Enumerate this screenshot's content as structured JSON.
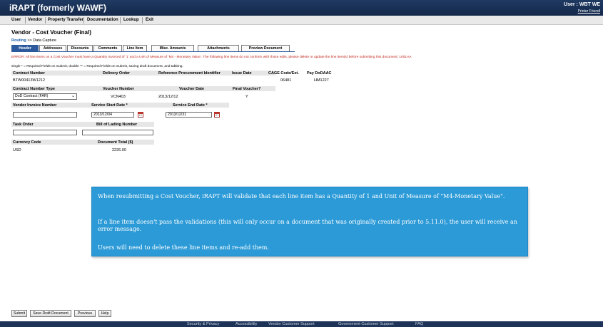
{
  "app": {
    "brand": "iRAPT (formerly WAWF)",
    "user_label": "User : WBT WE",
    "printer_link": "Printer Friendl"
  },
  "menu": [
    "User",
    "Vendor",
    "Property Transfer",
    "Documentation",
    "Lookup",
    "Exit"
  ],
  "page": {
    "title": "Vendor - Cost Voucher (Final)",
    "breadcrumb_link": "Routing",
    "breadcrumb_sep": ">>",
    "breadcrumb_current": "Data Capture"
  },
  "tabs": [
    "Header",
    "Addresses",
    "Discounts",
    "Comments",
    "Line Item",
    "Misc. Amounts",
    "Attachments",
    "Preview Document"
  ],
  "messages": {
    "error": "ERROR: All line items on a Cost Voucher must have a Quantity Invoiced of '1' and a Unit of Measure of 'M4 - Monetary Value'. The following line items do not conform with those edits, please delete or update the line item(s) before submitting this document: 1001AA",
    "required_note": "single * = Required Fields on Submit; double ** = Required Fields on Submit, saving draft document, and tabbing."
  },
  "form": {
    "contract_number_label": "Contract Number",
    "contract_number": "BTW00413W1212",
    "delivery_order_label": "Delivery Order",
    "delivery_order": "",
    "ref_proc_id_label": "Reference Procurement Identifier",
    "issue_date_label": "Issue Date",
    "cage_label": "CAGE Code/Ext.",
    "cage": "06481",
    "pay_dodaac_label": "Pay DoDAAC",
    "pay_dodaac": "HM1227",
    "contract_type_label": "Contract Number Type",
    "contract_type": "DoD Contract (FAR)",
    "voucher_number_label": "Voucher Number",
    "voucher_number": "VCN403",
    "voucher_date_label": "Voucher Date",
    "voucher_date": "2013/12/12",
    "final_voucher_label": "Final Voucher?",
    "final_voucher": "Y",
    "vendor_invoice_label": "Vendor Invoice Number",
    "vendor_invoice": "",
    "service_start_label": "Service Start Date *",
    "service_start": "2013/12/04",
    "service_end_label": "Service End Date *",
    "service_end": "2013/12/31",
    "task_order_label": "Task Order",
    "task_order": "",
    "bill_of_lading_label": "Bill of Lading Number",
    "bill_of_lading": "",
    "currency_label": "Currency Code",
    "currency": "USD",
    "doc_total_label": "Document Total ($)",
    "doc_total": "2226.00"
  },
  "callout": {
    "p1": "When resubmitting a Cost Voucher, iRAPT will validate that each line item has a Quantity of 1 and Unit of Measure of \"M4-Monetary Value\".",
    "p2": "If a line item doesn't pass the validations (this will only occur on a document that was originally created prior to 5.11.0), the user will receive an error message.",
    "p3": "Users will need to delete these line items and re-add them."
  },
  "buttons": [
    "Submit",
    "Save Draft Document",
    "Previous",
    "Help"
  ],
  "footer": [
    "Security & Privacy",
    "Accessibility",
    "Vendor Customer Support",
    "Government Customer Support",
    "FAQ"
  ],
  "colors": {
    "header_bg": "#1f3a63",
    "active_tab": "#2c5a9c",
    "error_text": "#c0261b",
    "callout_bg": "#2b9ad7",
    "link": "#1a5fa8"
  },
  "icons": {
    "select_arrow": "chevron-down-icon",
    "date_picker": "calendar-icon"
  }
}
